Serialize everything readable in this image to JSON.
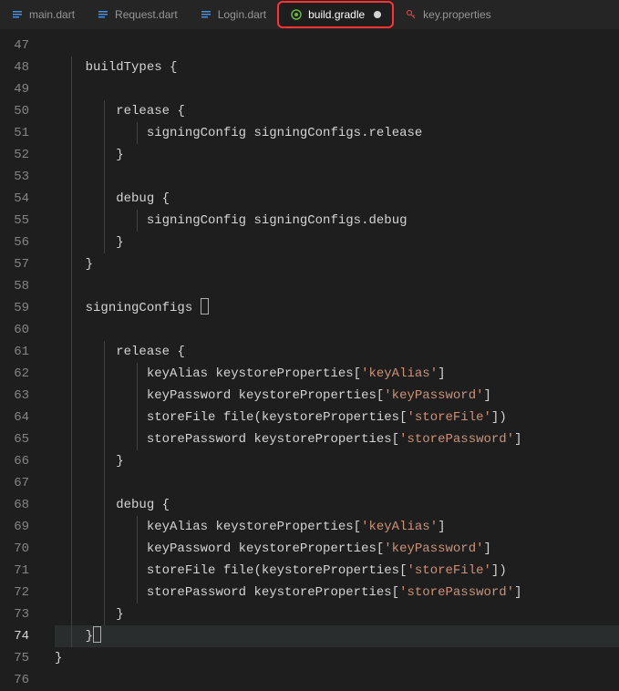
{
  "tabs": [
    {
      "label": "main.dart",
      "icon": "dart",
      "active": false,
      "highlighted": false,
      "dirty": false
    },
    {
      "label": "Request.dart",
      "icon": "dart",
      "active": false,
      "highlighted": false,
      "dirty": false
    },
    {
      "label": "Login.dart",
      "icon": "dart",
      "active": false,
      "highlighted": false,
      "dirty": false
    },
    {
      "label": "build.gradle",
      "icon": "gradle",
      "active": true,
      "highlighted": true,
      "dirty": true
    },
    {
      "label": "key.properties",
      "icon": "key",
      "active": false,
      "highlighted": false,
      "dirty": false
    }
  ],
  "line_start": 47,
  "line_end": 76,
  "current_line": 74,
  "code_lines": [
    {
      "n": 47,
      "indent": 0,
      "tokens": []
    },
    {
      "n": 48,
      "indent": 1,
      "tokens": [
        {
          "t": "buildTypes ",
          "c": "kw"
        },
        {
          "t": "{",
          "c": "punc"
        }
      ]
    },
    {
      "n": 49,
      "indent": 1,
      "tokens": []
    },
    {
      "n": 50,
      "indent": 2,
      "tokens": [
        {
          "t": "release ",
          "c": "kw"
        },
        {
          "t": "{",
          "c": "punc"
        }
      ]
    },
    {
      "n": 51,
      "indent": 3,
      "tokens": [
        {
          "t": "signingConfig signingConfigs",
          "c": "kw"
        },
        {
          "t": ".",
          "c": "punc"
        },
        {
          "t": "release",
          "c": "kw"
        }
      ]
    },
    {
      "n": 52,
      "indent": 2,
      "tokens": [
        {
          "t": "}",
          "c": "punc"
        }
      ]
    },
    {
      "n": 53,
      "indent": 2,
      "tokens": []
    },
    {
      "n": 54,
      "indent": 2,
      "tokens": [
        {
          "t": "debug ",
          "c": "kw"
        },
        {
          "t": "{",
          "c": "punc"
        }
      ]
    },
    {
      "n": 55,
      "indent": 3,
      "tokens": [
        {
          "t": "signingConfig signingConfigs",
          "c": "kw"
        },
        {
          "t": ".",
          "c": "punc"
        },
        {
          "t": "debug",
          "c": "kw"
        }
      ]
    },
    {
      "n": 56,
      "indent": 2,
      "tokens": [
        {
          "t": "}",
          "c": "punc"
        }
      ]
    },
    {
      "n": 57,
      "indent": 1,
      "tokens": [
        {
          "t": "}",
          "c": "punc"
        }
      ]
    },
    {
      "n": 58,
      "indent": 1,
      "tokens": []
    },
    {
      "n": 59,
      "indent": 1,
      "tokens": [
        {
          "t": "signingConfigs ",
          "c": "kw"
        },
        {
          "t": "{",
          "c": "punc",
          "cursor": true
        }
      ]
    },
    {
      "n": 60,
      "indent": 1,
      "tokens": []
    },
    {
      "n": 61,
      "indent": 2,
      "tokens": [
        {
          "t": "release ",
          "c": "kw"
        },
        {
          "t": "{",
          "c": "punc"
        }
      ]
    },
    {
      "n": 62,
      "indent": 3,
      "tokens": [
        {
          "t": "keyAlias keystoreProperties",
          "c": "kw"
        },
        {
          "t": "[",
          "c": "punc"
        },
        {
          "t": "'keyAlias'",
          "c": "str"
        },
        {
          "t": "]",
          "c": "punc"
        }
      ]
    },
    {
      "n": 63,
      "indent": 3,
      "tokens": [
        {
          "t": "keyPassword keystoreProperties",
          "c": "kw"
        },
        {
          "t": "[",
          "c": "punc"
        },
        {
          "t": "'keyPassword'",
          "c": "str"
        },
        {
          "t": "]",
          "c": "punc"
        }
      ]
    },
    {
      "n": 64,
      "indent": 3,
      "tokens": [
        {
          "t": "storeFile file",
          "c": "kw"
        },
        {
          "t": "(",
          "c": "punc"
        },
        {
          "t": "keystoreProperties",
          "c": "kw"
        },
        {
          "t": "[",
          "c": "punc"
        },
        {
          "t": "'storeFile'",
          "c": "str"
        },
        {
          "t": "])",
          "c": "punc"
        }
      ]
    },
    {
      "n": 65,
      "indent": 3,
      "tokens": [
        {
          "t": "storePassword keystoreProperties",
          "c": "kw"
        },
        {
          "t": "[",
          "c": "punc"
        },
        {
          "t": "'storePassword'",
          "c": "str"
        },
        {
          "t": "]",
          "c": "punc"
        }
      ]
    },
    {
      "n": 66,
      "indent": 2,
      "tokens": [
        {
          "t": "}",
          "c": "punc"
        }
      ]
    },
    {
      "n": 67,
      "indent": 2,
      "tokens": []
    },
    {
      "n": 68,
      "indent": 2,
      "tokens": [
        {
          "t": "debug ",
          "c": "kw"
        },
        {
          "t": "{",
          "c": "punc"
        }
      ]
    },
    {
      "n": 69,
      "indent": 3,
      "tokens": [
        {
          "t": "keyAlias keystoreProperties",
          "c": "kw"
        },
        {
          "t": "[",
          "c": "punc"
        },
        {
          "t": "'keyAlias'",
          "c": "str"
        },
        {
          "t": "]",
          "c": "punc"
        }
      ]
    },
    {
      "n": 70,
      "indent": 3,
      "tokens": [
        {
          "t": "keyPassword keystoreProperties",
          "c": "kw"
        },
        {
          "t": "[",
          "c": "punc"
        },
        {
          "t": "'keyPassword'",
          "c": "str"
        },
        {
          "t": "]",
          "c": "punc"
        }
      ]
    },
    {
      "n": 71,
      "indent": 3,
      "tokens": [
        {
          "t": "storeFile file",
          "c": "kw"
        },
        {
          "t": "(",
          "c": "punc"
        },
        {
          "t": "keystoreProperties",
          "c": "kw"
        },
        {
          "t": "[",
          "c": "punc"
        },
        {
          "t": "'storeFile'",
          "c": "str"
        },
        {
          "t": "])",
          "c": "punc"
        }
      ]
    },
    {
      "n": 72,
      "indent": 3,
      "tokens": [
        {
          "t": "storePassword keystoreProperties",
          "c": "kw"
        },
        {
          "t": "[",
          "c": "punc"
        },
        {
          "t": "'storePassword'",
          "c": "str"
        },
        {
          "t": "]",
          "c": "punc"
        }
      ]
    },
    {
      "n": 73,
      "indent": 2,
      "tokens": [
        {
          "t": "}",
          "c": "punc"
        }
      ]
    },
    {
      "n": 74,
      "indent": 1,
      "tokens": [
        {
          "t": "}",
          "c": "punc",
          "endcursor": true
        }
      ]
    },
    {
      "n": 75,
      "indent": 0,
      "tokens": [
        {
          "t": "}",
          "c": "punc"
        }
      ]
    },
    {
      "n": 76,
      "indent": 0,
      "tokens": []
    }
  ]
}
